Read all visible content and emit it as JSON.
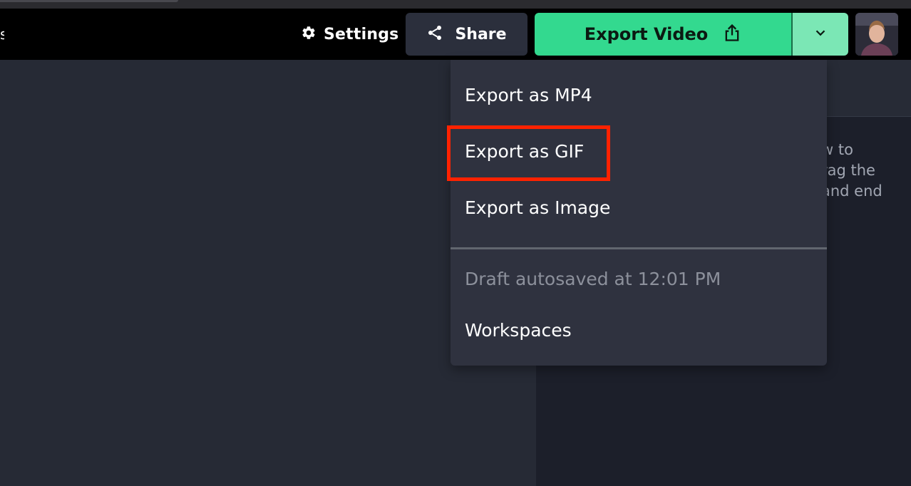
{
  "topbar": {
    "settings_label": "Settings",
    "share_label": "Share",
    "export_label": "Export Video",
    "edge_glyph": "s"
  },
  "icons": {
    "settings": "gear-icon",
    "share": "share-icon",
    "export": "upload-icon",
    "caret": "chevron-down-icon"
  },
  "colors": {
    "export_accent": "#33d98f",
    "export_caret_bg": "#7be7b5",
    "highlight": "#ff2200"
  },
  "dropdown": {
    "items": [
      {
        "label": "Export as MP4"
      },
      {
        "label": "Export as GIF"
      },
      {
        "label": "Export as Image"
      }
    ],
    "autosave_text": "Draft autosaved at 12:01 PM",
    "workspaces_label": "Workspaces"
  },
  "right_panel": {
    "text": "w to\nrag the\nand end"
  }
}
